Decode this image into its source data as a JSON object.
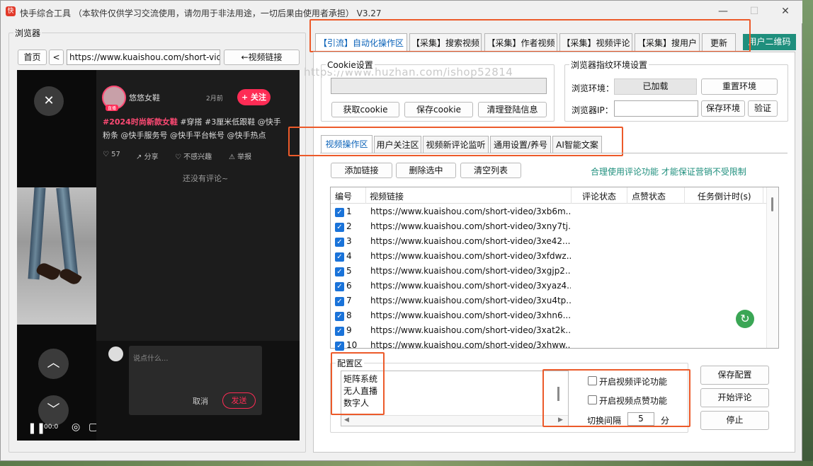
{
  "window": {
    "title": "快手综合工具 （本软件仅供学习交流使用，请勿用于非法用途，一切后果由使用者承担） V3.27",
    "icon_text": "快"
  },
  "browser_group": {
    "title": "浏览器",
    "home_label": "首页",
    "back_label": "<",
    "url": "https://www.kuaishou.com/short-vide",
    "video_link_label": "←视频链接"
  },
  "preview": {
    "author": "悠悠女鞋",
    "avatar_badge": "直播",
    "time": "2月前",
    "follow_label": "+ 关注",
    "description_tag": "#2024时尚新款女鞋",
    "description_rest": " #穿搭 #3厘米低跟鞋 @快手粉条 @快手服务号 @快手平台帐号 @快手热点",
    "likes": "57",
    "share_label": "分享",
    "dislike_label": "不感兴趣",
    "report_label": "举报",
    "no_comments": "还没有评论~",
    "comment_placeholder": "说点什么...",
    "cancel_label": "取消",
    "send_label": "发送",
    "time_code": "00:0"
  },
  "top_tabs": [
    "【引流】自动化操作区",
    "【采集】搜索视频",
    "【采集】作者视频",
    "【采集】视频评论",
    "【采集】搜用户",
    "更新"
  ],
  "qr_button": "用户二维码",
  "watermark": "https://www.huzhan.com/ishop52814",
  "cookie": {
    "title": "Cookie设置",
    "get_label": "获取cookie",
    "save_label": "保存cookie",
    "clear_label": "清理登陆信息"
  },
  "fingerprint": {
    "title": "浏览器指纹环境设置",
    "env_label": "浏览环境：",
    "env_value": "已加载",
    "reset_label": "重置环境",
    "ip_label": "浏览器IP：",
    "save_env_label": "保存环境",
    "verify_label": "验证"
  },
  "sub_tabs": [
    "视频操作区",
    "用户关注区",
    "视频新评论监听",
    "通用设置/养号",
    "AI智能文案"
  ],
  "actions": {
    "add_link": "添加链接",
    "delete_selected": "删除选中",
    "clear_list": "清空列表",
    "notice": "合理使用评论功能 才能保证营销不受限制"
  },
  "table": {
    "headers": [
      "编号",
      "视频链接",
      "评论状态",
      "点赞状态",
      "任务倒计时(s)"
    ],
    "rows": [
      {
        "id": "1",
        "url": "https://www.kuaishou.com/short-video/3xb6m..."
      },
      {
        "id": "2",
        "url": "https://www.kuaishou.com/short-video/3xny7tj..."
      },
      {
        "id": "3",
        "url": "https://www.kuaishou.com/short-video/3xe42..."
      },
      {
        "id": "4",
        "url": "https://www.kuaishou.com/short-video/3xfdwz..."
      },
      {
        "id": "5",
        "url": "https://www.kuaishou.com/short-video/3xgjp2..."
      },
      {
        "id": "6",
        "url": "https://www.kuaishou.com/short-video/3xyaz4..."
      },
      {
        "id": "7",
        "url": "https://www.kuaishou.com/short-video/3xu4tp..."
      },
      {
        "id": "8",
        "url": "https://www.kuaishou.com/short-video/3xhn6..."
      },
      {
        "id": "9",
        "url": "https://www.kuaishou.com/short-video/3xat2k..."
      },
      {
        "id": "10",
        "url": "https://www.kuaishou.com/short-video/3xhww..."
      }
    ]
  },
  "config": {
    "title": "配置区",
    "lines": [
      "矩阵系统",
      "无人直播",
      "数字人"
    ],
    "comment_toggle": "开启视频评论功能",
    "like_toggle": "开启视频点赞功能",
    "interval_label": "切换间隔",
    "interval_value": "5",
    "interval_unit": "分",
    "save_label": "保存配置",
    "start_label": "开始评论",
    "stop_label": "停止"
  },
  "colors": {
    "accent_blue": "#1a73d9",
    "teal": "#1f8f7d",
    "red_highlight": "#ec5a2a",
    "follow_red": "#fe2c55"
  }
}
